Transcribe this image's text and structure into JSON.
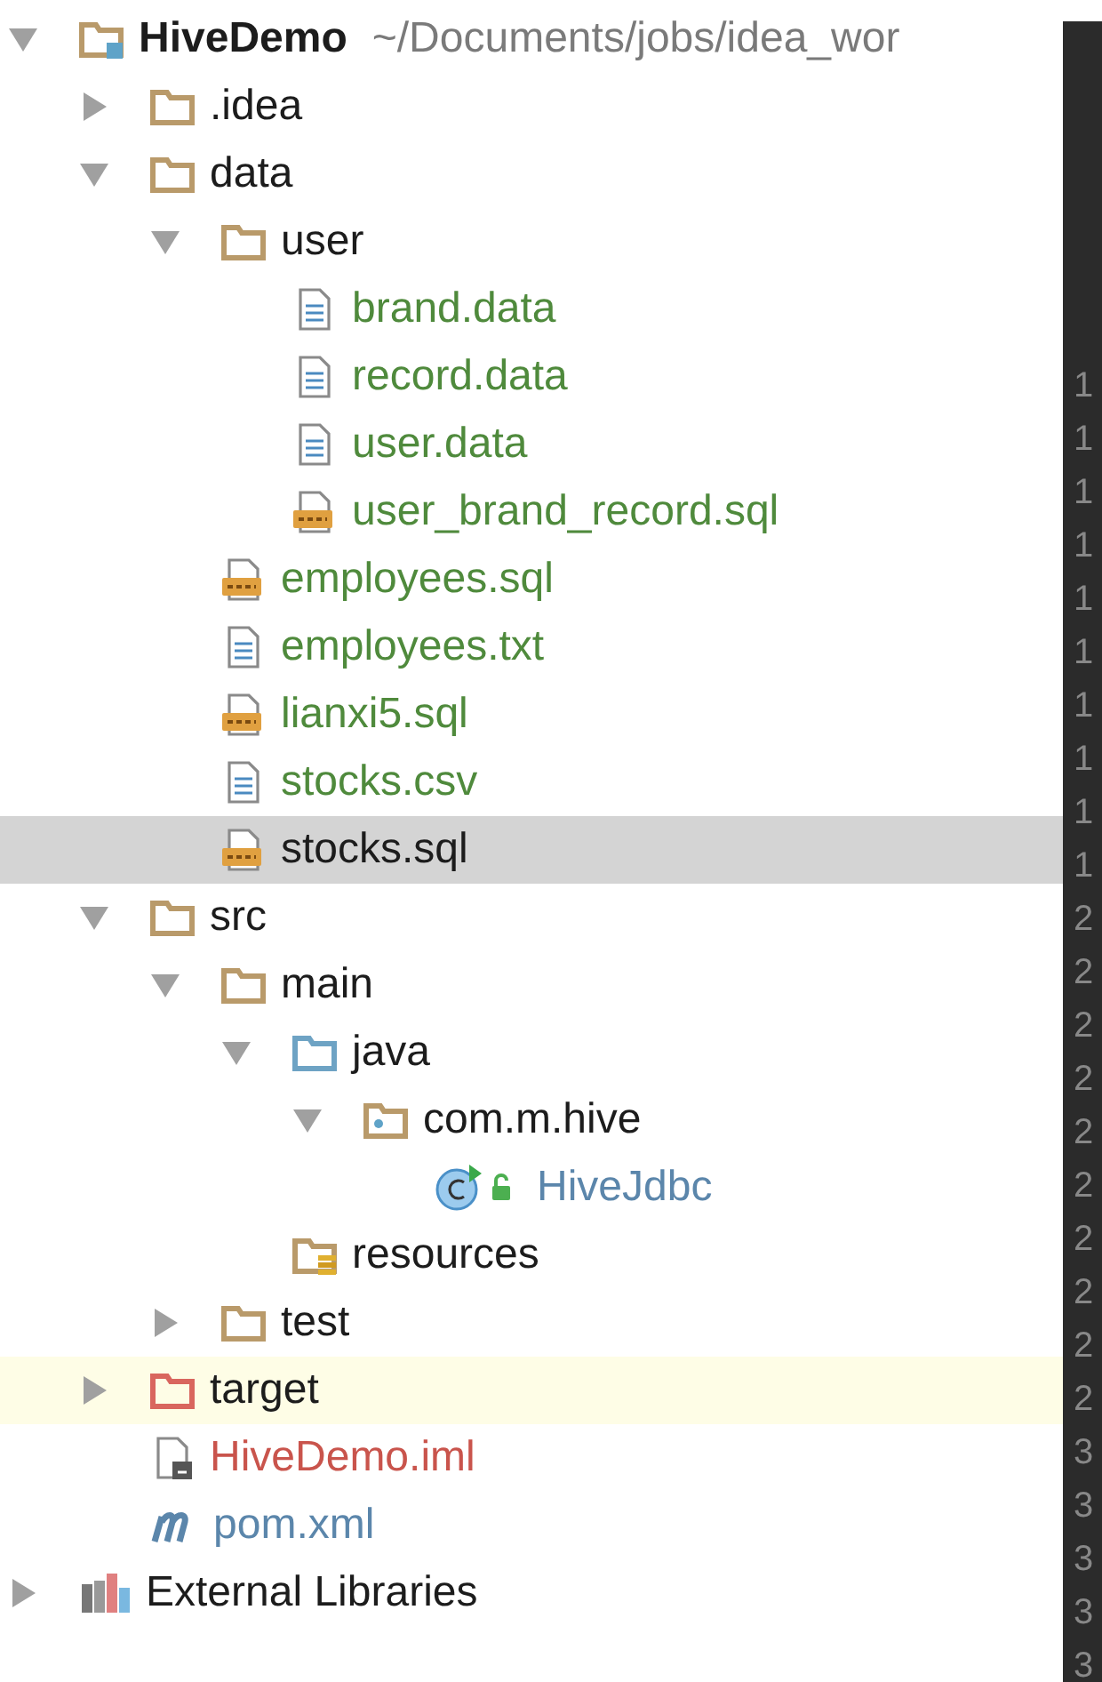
{
  "tree": [
    {
      "label": "HiveDemo",
      "path": "~/Documents/jobs/idea_wor",
      "kind": "module",
      "color": "#1c1c1c",
      "expanded": true,
      "selected": false,
      "highlighted": false,
      "children": [
        {
          "label": ".idea",
          "kind": "folder",
          "color": "#1c1c1c",
          "expanded": false,
          "selected": false,
          "highlighted": false
        },
        {
          "label": "data",
          "kind": "folder",
          "color": "#1c1c1c",
          "expanded": true,
          "selected": false,
          "highlighted": false,
          "children": [
            {
              "label": "user",
              "kind": "folder",
              "color": "#1c1c1c",
              "expanded": true,
              "selected": false,
              "highlighted": false,
              "children": [
                {
                  "label": "brand.data",
                  "kind": "text-file",
                  "color": "#4f8a3c",
                  "selected": false,
                  "highlighted": false
                },
                {
                  "label": "record.data",
                  "kind": "text-file",
                  "color": "#4f8a3c",
                  "selected": false,
                  "highlighted": false
                },
                {
                  "label": "user.data",
                  "kind": "text-file",
                  "color": "#4f8a3c",
                  "selected": false,
                  "highlighted": false
                },
                {
                  "label": "user_brand_record.sql",
                  "kind": "sql-file",
                  "color": "#4f8a3c",
                  "selected": false,
                  "highlighted": false
                }
              ]
            },
            {
              "label": "employees.sql",
              "kind": "sql-file",
              "color": "#4f8a3c",
              "selected": false,
              "highlighted": false
            },
            {
              "label": "employees.txt",
              "kind": "text-file",
              "color": "#4f8a3c",
              "selected": false,
              "highlighted": false
            },
            {
              "label": "lianxi5.sql",
              "kind": "sql-file",
              "color": "#4f8a3c",
              "selected": false,
              "highlighted": false
            },
            {
              "label": "stocks.csv",
              "kind": "text-file",
              "color": "#4f8a3c",
              "selected": false,
              "highlighted": false
            },
            {
              "label": "stocks.sql",
              "kind": "sql-file",
              "color": "#1c1c1c",
              "selected": true,
              "highlighted": false
            }
          ]
        },
        {
          "label": "src",
          "kind": "folder",
          "color": "#1c1c1c",
          "expanded": true,
          "selected": false,
          "highlighted": false,
          "children": [
            {
              "label": "main",
              "kind": "folder",
              "color": "#1c1c1c",
              "expanded": true,
              "selected": false,
              "highlighted": false,
              "children": [
                {
                  "label": "java",
                  "kind": "source-folder",
                  "color": "#1c1c1c",
                  "expanded": true,
                  "selected": false,
                  "highlighted": false,
                  "children": [
                    {
                      "label": "com.m.hive",
                      "kind": "package",
                      "color": "#1c1c1c",
                      "expanded": true,
                      "selected": false,
                      "highlighted": false,
                      "children": [
                        {
                          "label": "HiveJdbc",
                          "kind": "class",
                          "color": "#5b86ab",
                          "selected": false,
                          "highlighted": false
                        }
                      ]
                    }
                  ]
                },
                {
                  "label": "resources",
                  "kind": "resources-folder",
                  "color": "#1c1c1c",
                  "selected": false,
                  "highlighted": false
                }
              ]
            },
            {
              "label": "test",
              "kind": "folder",
              "color": "#1c1c1c",
              "expanded": false,
              "selected": false,
              "highlighted": false
            }
          ]
        },
        {
          "label": "target",
          "kind": "excluded-folder",
          "color": "#1c1c1c",
          "expanded": false,
          "selected": false,
          "highlighted": true
        },
        {
          "label": "HiveDemo.iml",
          "kind": "iml-file",
          "color": "#c9544c",
          "selected": false,
          "highlighted": false
        },
        {
          "label": "pom.xml",
          "kind": "maven-file",
          "color": "#5b86ab",
          "selected": false,
          "highlighted": false
        }
      ]
    },
    {
      "label": "External Libraries",
      "kind": "libraries",
      "color": "#1c1c1c",
      "expanded": false,
      "selected": false,
      "highlighted": false
    }
  ],
  "gutter": {
    "line_numbers": [
      "1",
      "1",
      "1",
      "1",
      "1",
      "1",
      "1",
      "1",
      "1",
      "1",
      "2",
      "2",
      "2",
      "2",
      "2",
      "2",
      "2",
      "2",
      "2",
      "2",
      "3",
      "3",
      "3",
      "3",
      "3"
    ]
  }
}
